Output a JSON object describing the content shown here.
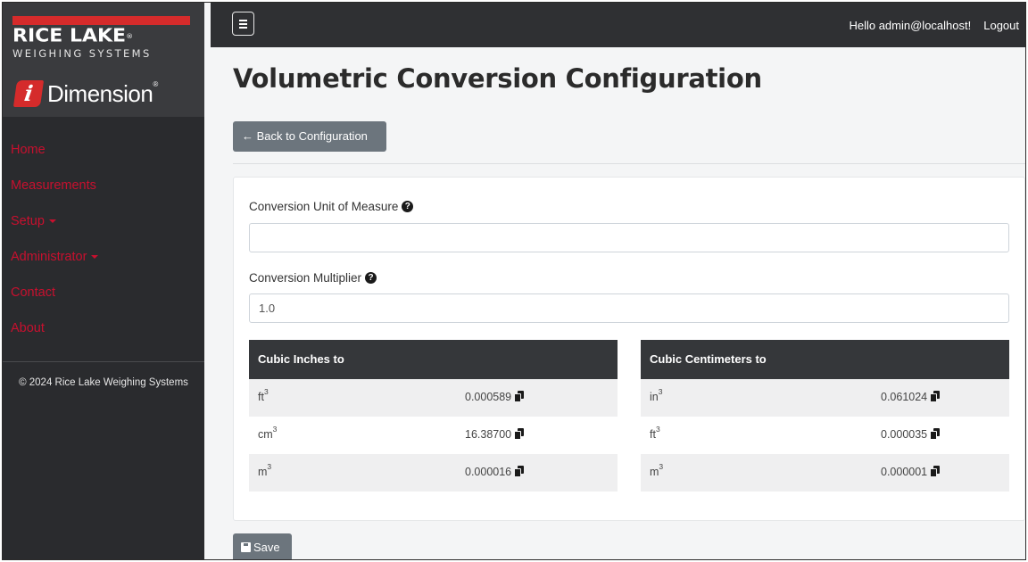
{
  "brand": {
    "name": "RICE LAKE",
    "registered": "®",
    "subtitle": "WEIGHING SYSTEMS",
    "product_letter": "i",
    "product_name": "Dimension",
    "product_registered": "®"
  },
  "sidebar": {
    "items": [
      {
        "label": "Home",
        "dropdown": false
      },
      {
        "label": "Measurements",
        "dropdown": false
      },
      {
        "label": "Setup",
        "dropdown": true
      },
      {
        "label": "Administrator",
        "dropdown": true
      },
      {
        "label": "Contact",
        "dropdown": false
      },
      {
        "label": "About",
        "dropdown": false
      }
    ],
    "copyright": "© 2024 Rice Lake Weighing Systems"
  },
  "topbar": {
    "greeting": "Hello admin@localhost!",
    "logout": "Logout",
    "menu_icon": "hamburger-icon"
  },
  "page": {
    "title": "Volumetric Conversion Configuration",
    "back_button": "← Back to Configuration",
    "save_button": "Save"
  },
  "form": {
    "unit_label": "Conversion Unit of Measure",
    "unit_value": "",
    "multiplier_label": "Conversion Multiplier",
    "multiplier_value": "1.0",
    "help_glyph": "?"
  },
  "tables": {
    "cubic_inches": {
      "header": "Cubic Inches to",
      "rows": [
        {
          "unit": "ft",
          "exp": "3",
          "value": "0.000589"
        },
        {
          "unit": "cm",
          "exp": "3",
          "value": "16.38700"
        },
        {
          "unit": "m",
          "exp": "3",
          "value": "0.000016"
        }
      ]
    },
    "cubic_centimeters": {
      "header": "Cubic Centimeters to",
      "rows": [
        {
          "unit": "in",
          "exp": "3",
          "value": "0.061024"
        },
        {
          "unit": "ft",
          "exp": "3",
          "value": "0.000035"
        },
        {
          "unit": "m",
          "exp": "3",
          "value": "0.000001"
        }
      ]
    }
  },
  "colors": {
    "brand_red": "#d52b2b",
    "nav_link": "#c8102e",
    "sidebar_bg": "#2a2b2e",
    "topbar_bg": "#2f3033",
    "button_gray": "#6c757d",
    "table_header": "#35373a"
  }
}
